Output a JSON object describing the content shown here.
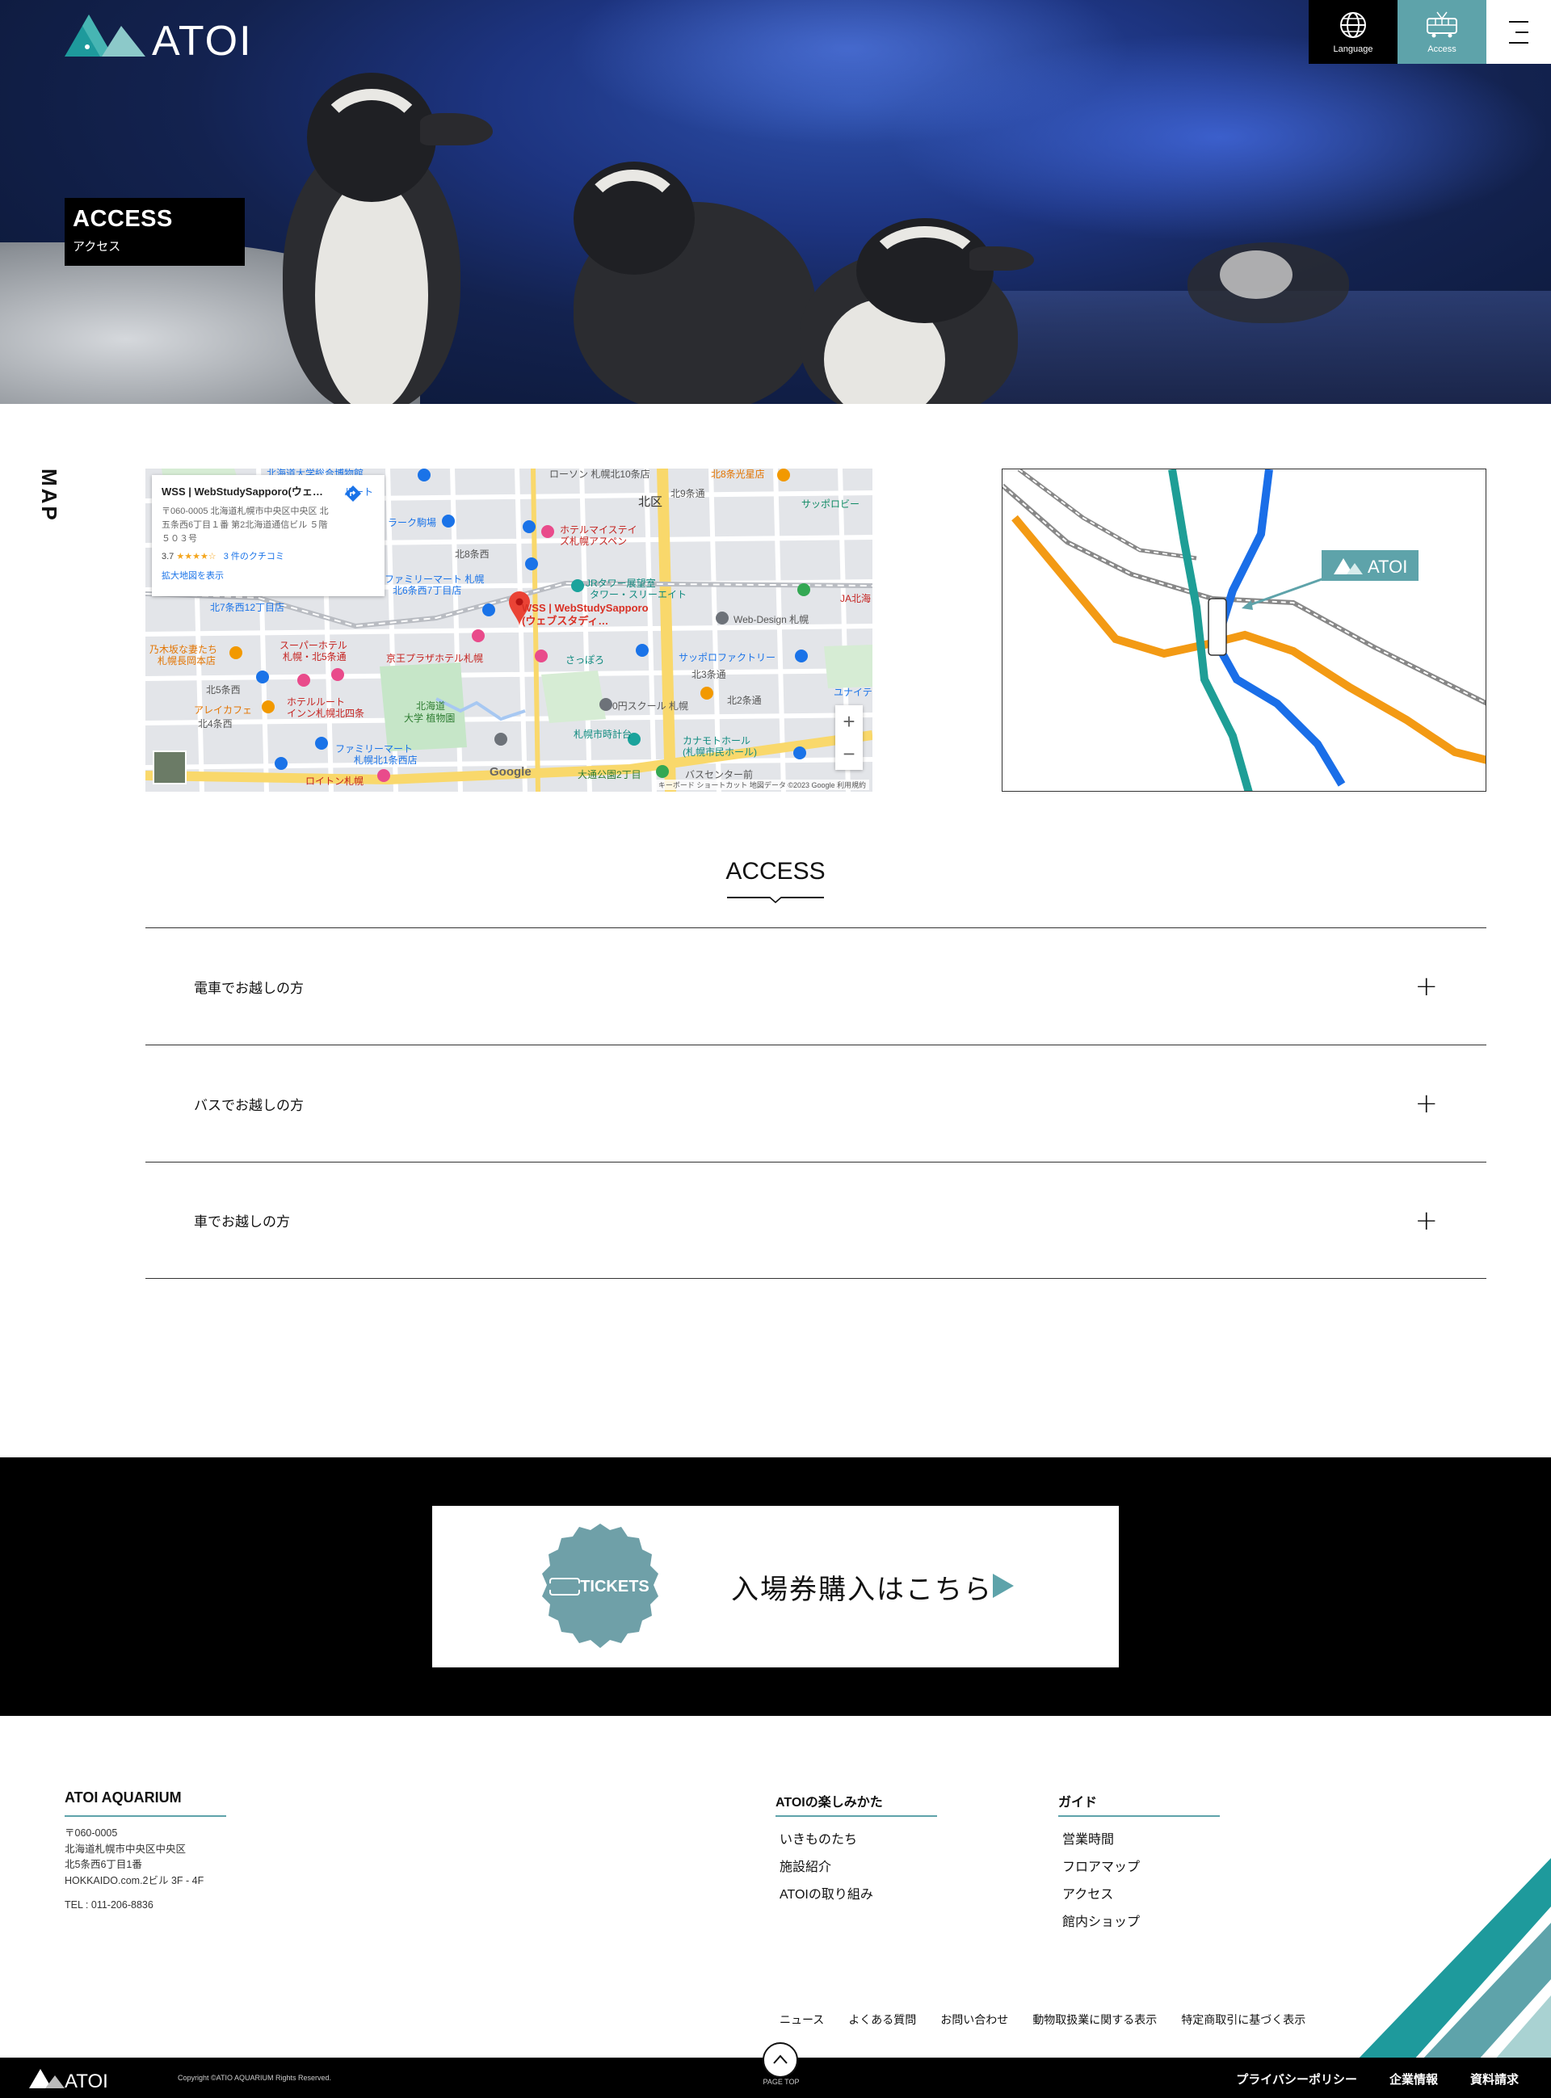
{
  "header": {
    "logo_text": "ATOI",
    "language_label": "Language",
    "access_label": "Access"
  },
  "hero": {
    "title_en": "ACCESS",
    "title_ja": "アクセス"
  },
  "map_section": {
    "label": "MAP",
    "info_card": {
      "place_name": "WSS | WebStudySapporo(ウェ…",
      "route_label": "ルート",
      "address": "〒060-0005 北海道札幌市中央区中央区 北五条西6丁目１番 第2北海道通信ビル ５階 ５０３号",
      "rating": "3.7",
      "stars": "★★★★☆",
      "reviews": "3 件のクチコミ",
      "larger_map": "拡大地図を表示"
    },
    "pin_label_line1": "WSS | WebStudySapporo",
    "pin_label_line2": "(ウェブスタディ…",
    "streets": [
      "北海道大学総合博物館",
      "ローソン 札幌北10条店",
      "北8条光星店",
      "北区",
      "北9条通",
      "サッポロビー",
      "ラーク駒場",
      "ホテルマイステイ",
      "ズ札幌アスペン",
      "北8条西",
      "ファミリーマート 札幌",
      "北6条西7丁目店",
      "JRタワー展望室",
      "タワー・スリーエイト",
      "JA北海",
      "北7条西12丁目店",
      "Web-Design 札幌",
      "スーパーホテル",
      "札幌・北5条通",
      "京王プラザホテル札幌",
      "さっぽろ",
      "サッポロファクトリー",
      "乃木坂な妻たち",
      "札幌長岡本店",
      "北5条西",
      "北4条西",
      "ホテルルート",
      "インン札幌北四条",
      "北海道",
      "大学 植物園",
      "0円スクール 札幌",
      "北3条通",
      "北2条通",
      "ユナイテ",
      "アレイカフェ",
      "札幌市時計台",
      "カナモトホール",
      "(札幌市民ホール)",
      "ファミリーマート",
      "札幌北1条西店",
      "ロイトン札幌",
      "大通公園2丁目",
      "バスセンター前"
    ],
    "google": "Google",
    "zoom_in": "+",
    "zoom_out": "−",
    "footer_text": "キーボード ショートカット   地図データ ©2023 Google   利用規約",
    "route_map_badge": "ATOI"
  },
  "access": {
    "heading": "ACCESS",
    "items": [
      {
        "label": "電車でお越しの方",
        "toggle": "+"
      },
      {
        "label": "バスでお越しの方",
        "toggle": "+"
      },
      {
        "label": "車でお越しの方",
        "toggle": "+"
      }
    ]
  },
  "tickets": {
    "badge": "TICKETS",
    "text": "入場券購入はこちら"
  },
  "footer": {
    "brand": "ATOI AQUARIUM",
    "address_lines": [
      "〒060-0005",
      "北海道札幌市中央区中央区",
      "北5条西6丁目1番",
      "HOKKAIDO.com.2ビル 3F - 4F"
    ],
    "tel": "TEL : 011-206-8836",
    "col1": {
      "heading": "ATOIの楽しみかた",
      "links": [
        "いきものたち",
        "施設紹介",
        "ATOIの取り組み"
      ]
    },
    "col2": {
      "heading": "ガイド",
      "links": [
        "営業時間",
        "フロアマップ",
        "アクセス",
        "館内ショップ"
      ]
    },
    "sub_links": [
      "ニュース",
      "よくある質問",
      "お問い合わせ",
      "動物取扱業に関する表示",
      "特定商取引に基づく表示"
    ],
    "copyright": "Copyright ©ATIO AQUARIUM Rights Reserved.",
    "page_top": "PAGE TOP",
    "bottom_links": [
      "プライバシーポリシー",
      "企業情報",
      "資料請求"
    ],
    "bottom_logo": "ATOI"
  },
  "colors": {
    "accent": "#5ea3aa",
    "teal_dark": "#1e9a9c",
    "black": "#000000"
  }
}
